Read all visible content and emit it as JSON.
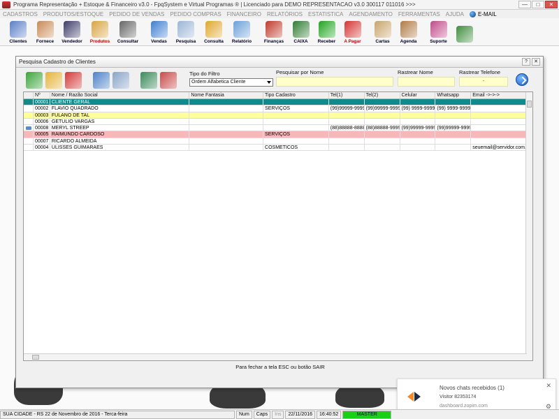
{
  "window": {
    "title": "Programa Representação + Estoque & Financeiro v3.0 - FpqSystem e Virtual Programas ® | Licenciado para DEMO REPRESENTACAO v3.0 300117 011016 >>>",
    "min": "—",
    "max": "□",
    "close": "✕"
  },
  "menu": {
    "items": [
      "CADASTROS",
      "PRODUTOS/ESTOQUE",
      "PEDIDO DE VENDAS",
      "PEDIDO COMPRAS",
      "FINANCEIRO",
      "RELATÓRIOS",
      "ESTATISTICA",
      "AGENDAMENTO",
      "FERRAMENTAS",
      "AJUDA"
    ],
    "email": "E-MAIL"
  },
  "toolbar": {
    "buttons": [
      {
        "label": "Clientes",
        "icon": "clients-icon",
        "color": "#5b7fc7"
      },
      {
        "label": "Fornece",
        "icon": "supplier-icon",
        "color": "#c98a54"
      },
      {
        "label": "Vendedor",
        "icon": "seller-icon",
        "color": "#3d3d6b"
      },
      {
        "label": "Produtos",
        "icon": "products-icon",
        "color": "#d9a441",
        "red": true
      },
      {
        "label": "Consultar",
        "icon": "consult-icon",
        "color": "#666666"
      },
      {
        "label": "Vendas",
        "icon": "sales-icon",
        "color": "#3d7fcf"
      },
      {
        "label": "Pesquisa",
        "icon": "search-icon",
        "color": "#9bb5d6"
      },
      {
        "label": "Consulta",
        "icon": "folder-icon",
        "color": "#e0a72e"
      },
      {
        "label": "Relatório",
        "icon": "report-icon",
        "color": "#6ca0d8"
      },
      {
        "label": "Finanças",
        "icon": "finance-icon",
        "color": "#c0392b"
      },
      {
        "label": "CAIXA",
        "icon": "cashier-icon",
        "color": "#2f7d32"
      },
      {
        "label": "Receber",
        "icon": "receive-icon",
        "color": "#1fa51f"
      },
      {
        "label": "A Pagar",
        "icon": "pay-icon",
        "color": "#d63333",
        "red": true
      },
      {
        "label": "Cartas",
        "icon": "letters-icon",
        "color": "#c9a46a"
      },
      {
        "label": "Agenda",
        "icon": "agenda-icon",
        "color": "#b07a45"
      },
      {
        "label": "Suporte",
        "icon": "support-icon",
        "color": "#c04a8a"
      },
      {
        "label": "",
        "icon": "exit-icon",
        "color": "#3e8e3e"
      }
    ]
  },
  "dialog": {
    "title": "Pesquisa Cadastro de Clientes",
    "help": "?",
    "close": "✕",
    "filter_type_label": "Tipo do Filtro",
    "filter_type_value": "Ordem Alfabetica Cliente",
    "search_name_label": "Pesquisar por Nome",
    "track_name_label": "Rastrear Nome",
    "track_phone_label": "Rastrear Telefone",
    "track_phone_value": "-",
    "close_hint": "Para fechar a tela ESC ou botão SAIR",
    "tools": [
      {
        "icon": "add-document-icon",
        "color": "#3aa53a"
      },
      {
        "icon": "edit-icon",
        "color": "#e5b43a"
      },
      {
        "icon": "delete-icon",
        "color": "#d43a3a"
      },
      {
        "icon": "bookmark-icon",
        "color": "#4d83c9"
      },
      {
        "icon": "print-icon",
        "color": "#8aa5c8"
      },
      {
        "icon": "export-icon",
        "color": "#3a8a5a"
      },
      {
        "icon": "email-icon",
        "color": "#c84a4a"
      }
    ]
  },
  "grid": {
    "headers": [
      "",
      "Nº",
      "Nome / Razão Social",
      "Nome Fantasia",
      "Tipo Cadastro",
      "Tel(1)",
      "Tel(2)",
      "Celular",
      "Whatsapp",
      "Email ->->->"
    ],
    "rows": [
      {
        "num": "00001",
        "name": "CLIENTE GERAL",
        "fantasy": "",
        "type": "",
        "tel1": "",
        "tel2": "",
        "cell": "",
        "whatsapp": "",
        "email": "",
        "bg": "#138a8a",
        "fg": "#ffffff"
      },
      {
        "num": "00002",
        "name": "FLAVIO QUADRADO",
        "fantasy": "",
        "type": "SERVIÇOS",
        "tel1": "(99)99999-9999",
        "tel2": "(99)99999-9999",
        "cell": "(99) 9999-9999",
        "whatsapp": "(99) 9999-9999",
        "email": "",
        "bg": "#ffffff",
        "fg": "#000000"
      },
      {
        "num": "00003",
        "name": "FULANO DE TAL",
        "fantasy": "",
        "type": "",
        "tel1": "",
        "tel2": "",
        "cell": "",
        "whatsapp": "",
        "email": "",
        "bg": "#ffff99",
        "fg": "#000000"
      },
      {
        "num": "00006",
        "name": "GETULIO VARGAS",
        "fantasy": "",
        "type": "",
        "tel1": "",
        "tel2": "",
        "cell": "",
        "whatsapp": "",
        "email": "",
        "bg": "#ffffff",
        "fg": "#000000"
      },
      {
        "num": "00008",
        "name": "MERYL STREEP",
        "fantasy": "",
        "type": "",
        "tel1": "(88)88888-8888",
        "tel2": "(88)88888-9999",
        "cell": "(99)99999-9999",
        "whatsapp": "(99)99999-9999",
        "email": "",
        "bg": "#ffffff",
        "fg": "#000000",
        "indicator": true
      },
      {
        "num": "00005",
        "name": "RAIMUNDO CARDOSO",
        "fantasy": "",
        "type": "SERVIÇOS",
        "tel1": "",
        "tel2": "",
        "cell": "",
        "whatsapp": "",
        "email": "",
        "bg": "#f6b8b8",
        "fg": "#000000"
      },
      {
        "num": "00007",
        "name": "RICARDO ALMEIDA",
        "fantasy": "",
        "type": "",
        "tel1": "",
        "tel2": "",
        "cell": "",
        "whatsapp": "",
        "email": "",
        "bg": "#ffffff",
        "fg": "#000000"
      },
      {
        "num": "00004",
        "name": "ULISSES GUIMARAES",
        "fantasy": "",
        "type": "COSMETICOS",
        "tel1": "",
        "tel2": "",
        "cell": "",
        "whatsapp": "",
        "email": "seuemail@servidor.com.b",
        "bg": "#ffffff",
        "fg": "#000000"
      }
    ]
  },
  "chat": {
    "title": "Novos chats recebidos (1)",
    "visitor": "Visitor 82353174",
    "domain": "dashboard.zopim.com",
    "close": "✕",
    "settings": "⚙"
  },
  "status": {
    "city": "SUA CIDADE - RS 22 de Novembro de 2016 - Terca-feira",
    "num": "Num",
    "caps": "Caps",
    "ins": "Ins",
    "date": "22/11/2016",
    "time": "16:40:52",
    "master": "MASTER"
  }
}
